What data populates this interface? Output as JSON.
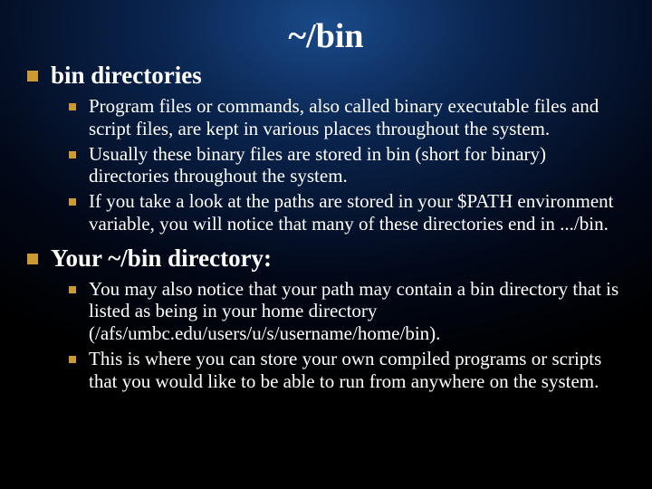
{
  "title": "~/bin",
  "sections": [
    {
      "heading": "bin directories",
      "items": [
        "Program files or commands, also called binary executable files and script files, are kept in various places throughout the system.",
        "Usually these binary files are stored in bin (short for binary) directories throughout the system.",
        "If you take a look at the paths are stored in your $PATH environment variable, you will notice that many of these directories end in .../bin."
      ]
    },
    {
      "heading": "Your ~/bin directory:",
      "items": [
        "You may also notice that your path may contain a bin directory that is listed as being in your home directory (/afs/umbc.edu/users/u/s/username/home/bin).",
        "This is where you can store your own compiled programs or scripts that you would like to be able to run from anywhere on the system."
      ]
    }
  ]
}
